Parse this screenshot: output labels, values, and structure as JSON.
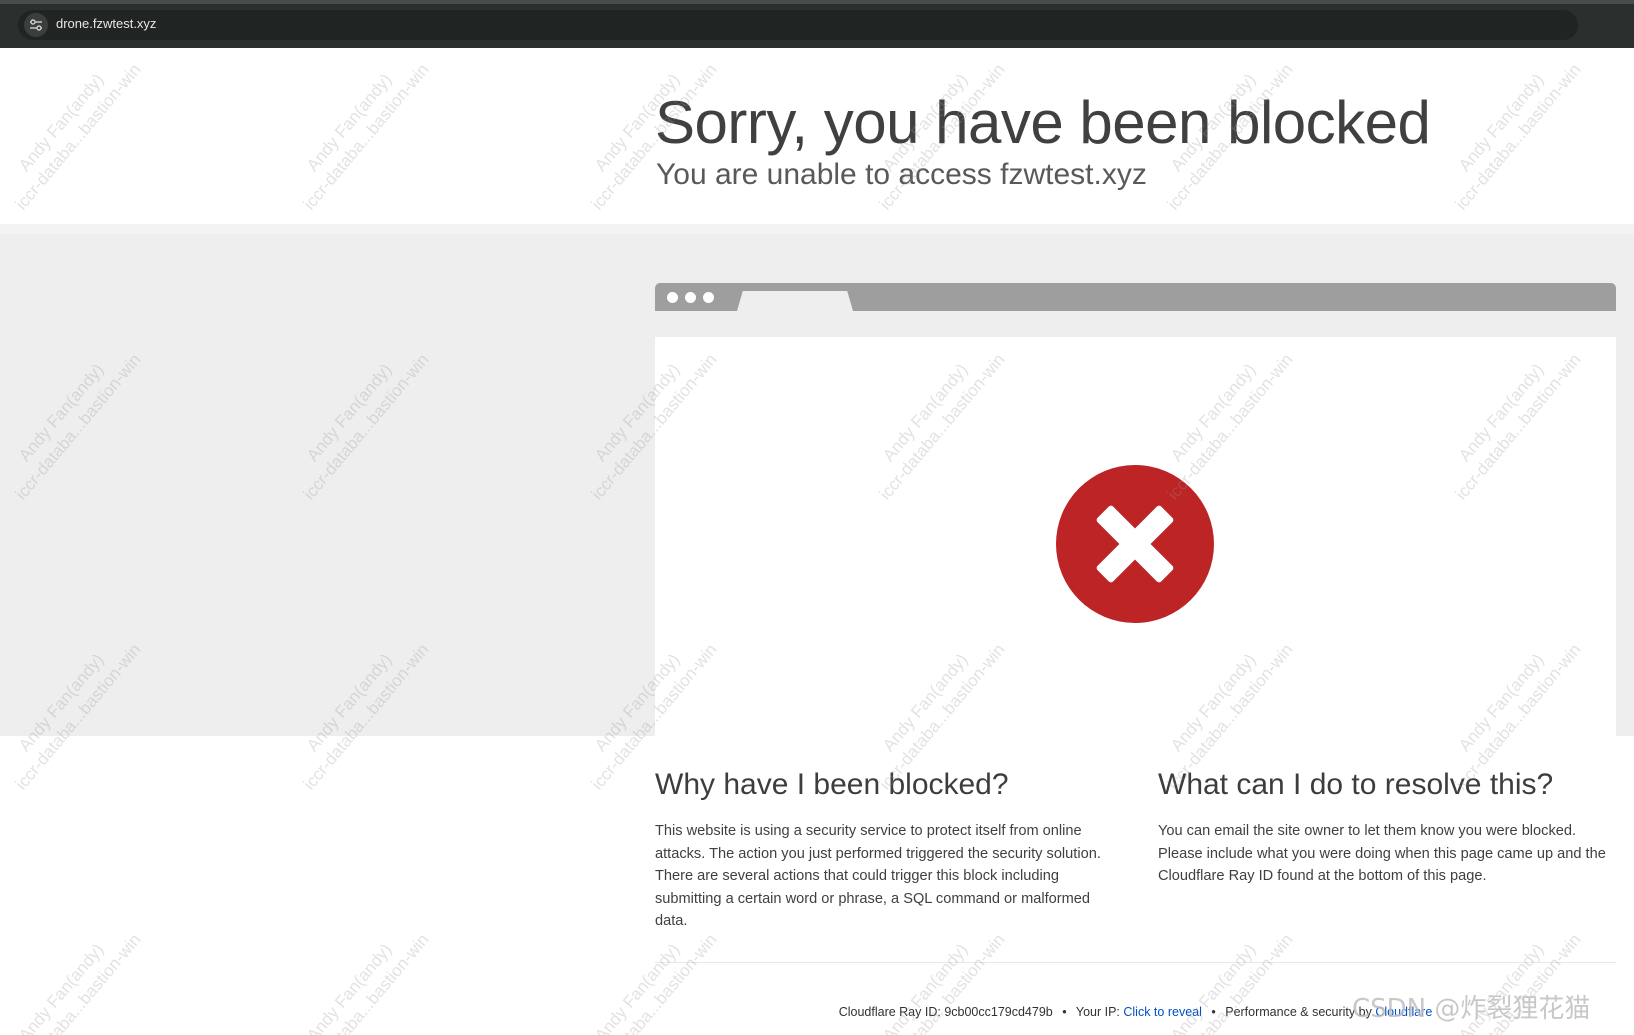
{
  "browser": {
    "url": "drone.fzwtest.xyz",
    "site_info_icon": "tune-icon"
  },
  "header": {
    "title": "Sorry, you have been blocked",
    "subtitle": "You are unable to access fzwtest.xyz"
  },
  "illustration": {
    "icon": "error-x-icon",
    "icon_color": "#bd2426"
  },
  "why": {
    "heading": "Why have I been blocked?",
    "body": "This website is using a security service to protect itself from online attacks. The action you just performed triggered the security solution. There are several actions that could trigger this block including submitting a certain word or phrase, a SQL command or malformed data."
  },
  "resolve": {
    "heading": "What can I do to resolve this?",
    "body": "You can email the site owner to let them know you were blocked. Please include what you were doing when this page came up and the Cloudflare Ray ID found at the bottom of this page."
  },
  "footer": {
    "ray_label": "Cloudflare Ray ID:",
    "ray_id": "9cb00cc179cd479b",
    "separator": "•",
    "ip_label": "Your IP:",
    "ip_link": "Click to reveal",
    "perf_label": "Performance & security by",
    "perf_link": "Cloudflare",
    "link_color": "#0051c3"
  },
  "watermark": {
    "line1": "Andy Fan(andy)",
    "line2": "iccr-databa...bastion-win",
    "csdn": "CSDN @炸裂狸花猫"
  }
}
